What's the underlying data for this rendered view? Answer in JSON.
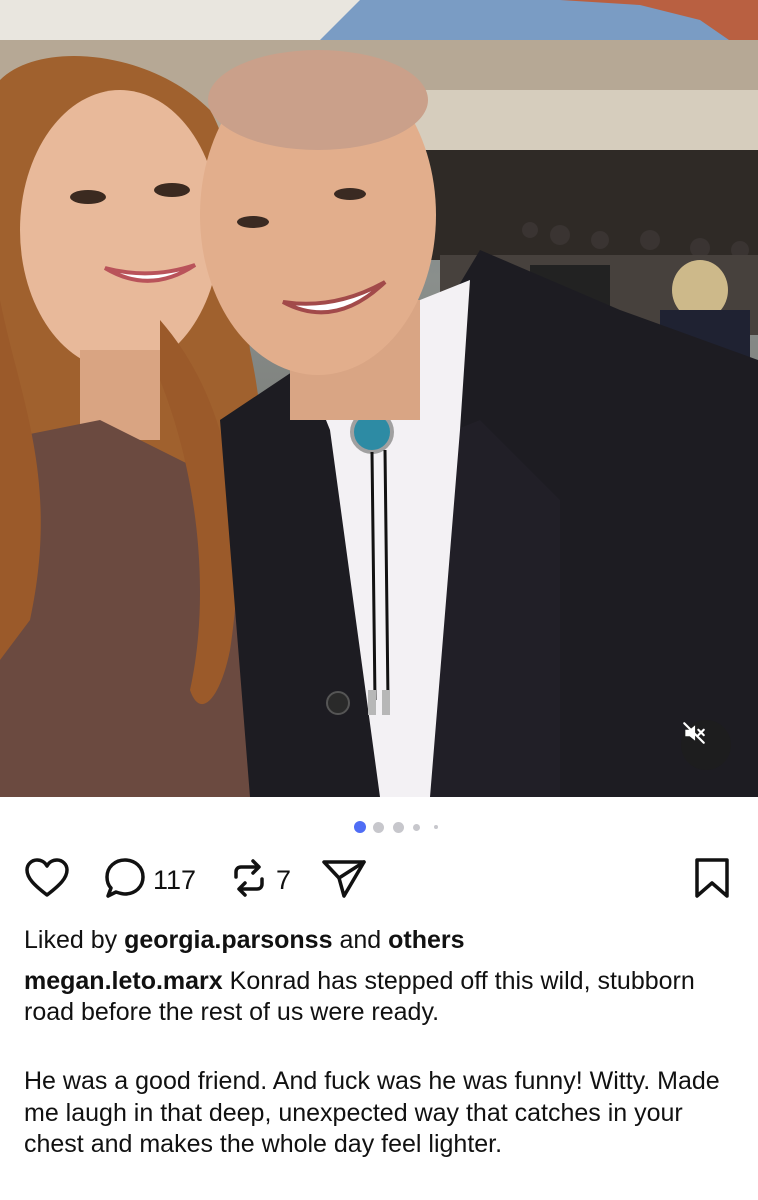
{
  "post": {
    "media": {
      "description_icon": "image-carousel",
      "mute_icon": "speaker-muted-icon"
    },
    "carousel": {
      "count": 5,
      "active_index": 0,
      "active_color": "#4f6df5",
      "inactive_color": "#c7c7cc"
    },
    "actions": {
      "like_icon": "heart-icon",
      "comment_icon": "comment-icon",
      "comment_count": "117",
      "repost_icon": "repost-icon",
      "repost_count": "7",
      "share_icon": "send-icon",
      "save_icon": "bookmark-icon"
    },
    "likes": {
      "prefix": "Liked by",
      "user": "georgia.parsonss",
      "conjunction": "and",
      "suffix": "others"
    },
    "caption": {
      "username": "megan.leto.marx",
      "text": "Konrad has stepped off this wild, stubborn road before the rest of us were ready.",
      "paragraph": "He was a good friend. And fuck was he was funny! Witty. Made me laugh in that deep, unexpected way that catches in your chest and makes the whole day feel lighter."
    }
  }
}
